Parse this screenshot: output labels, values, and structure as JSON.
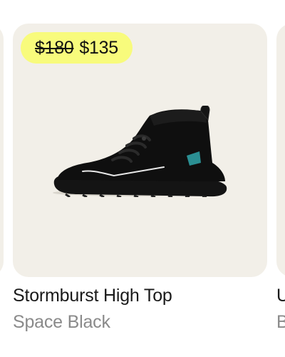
{
  "products": [
    {
      "title": "Stormburst High Top",
      "subtitle": "Space Black",
      "price_original": "$180",
      "price_sale": "$135",
      "image_icon": "black-high-top-sneaker",
      "badge_color": "#f8fb7c",
      "card_bg": "#f2efe8"
    }
  ],
  "next_card_peek": {
    "title_first_char": "U",
    "subtitle_first_char": "B"
  }
}
